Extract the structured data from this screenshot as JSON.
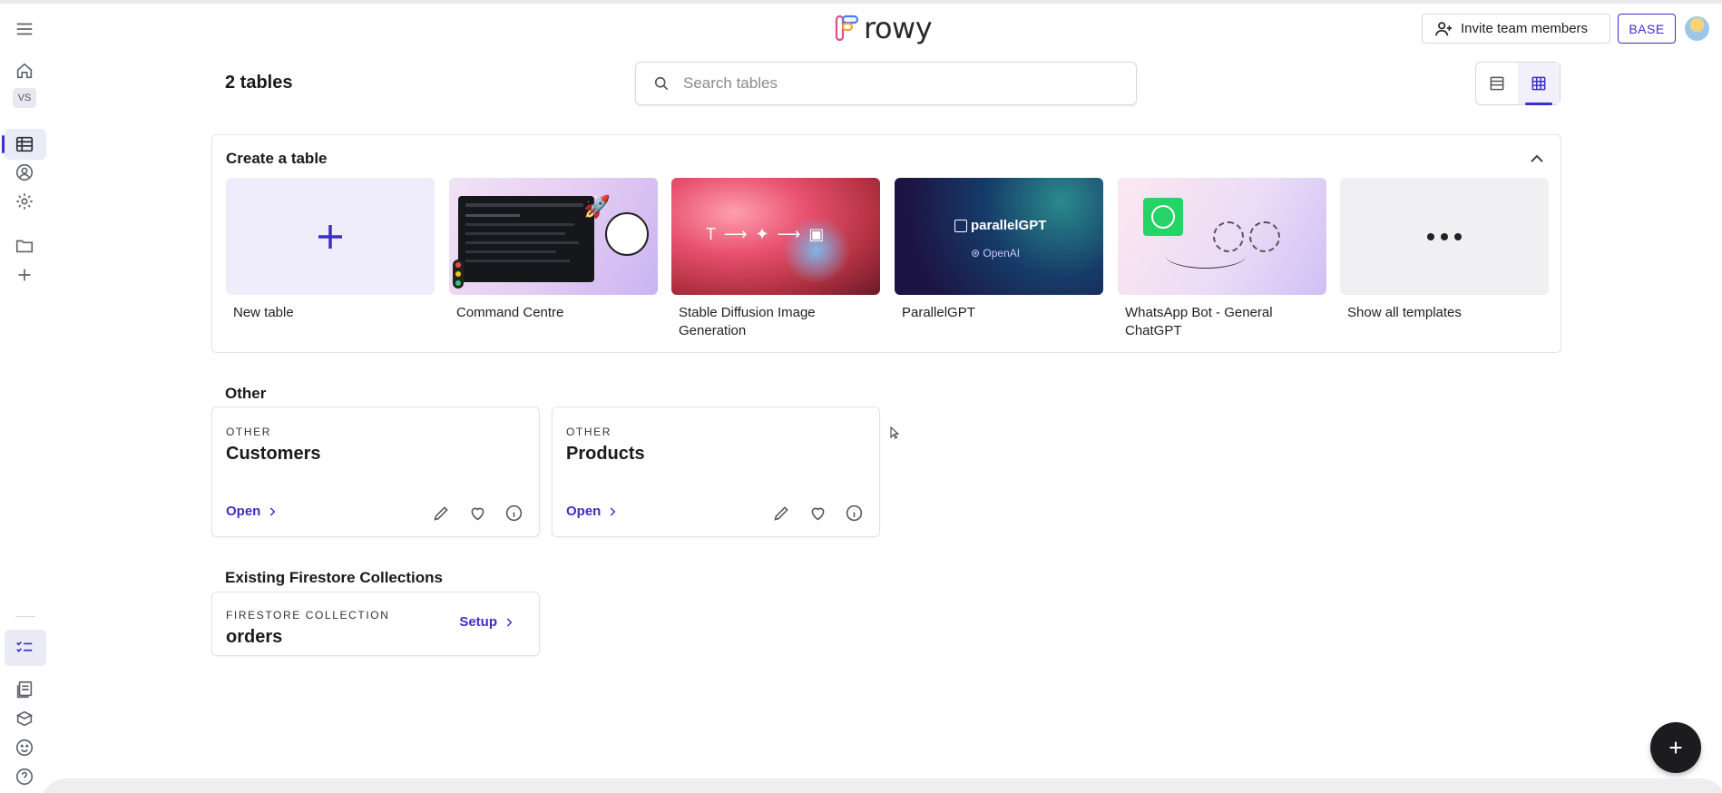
{
  "app": {
    "logo_text": "rowy"
  },
  "header": {
    "invite_label": "Invite team members",
    "base_label": "BASE"
  },
  "sidebar": {
    "workspace_badge": "VS",
    "items": [
      "menu",
      "home",
      "workspace",
      "tables",
      "users",
      "settings",
      "folder",
      "add",
      "checklist",
      "docs",
      "learn",
      "feedback",
      "help"
    ]
  },
  "tables_header": {
    "count_label": "2 tables",
    "search_placeholder": "Search tables"
  },
  "create": {
    "title": "Create a table",
    "templates": [
      {
        "label": "New table"
      },
      {
        "label": "Command Centre"
      },
      {
        "label": "Stable Diffusion Image Generation"
      },
      {
        "label": "ParallelGPT",
        "thumb_title": "parallelGPT",
        "thumb_sub": "OpenAI"
      },
      {
        "label": "WhatsApp Bot - General ChatGPT"
      },
      {
        "label": "Show all templates"
      }
    ]
  },
  "sections": {
    "other": {
      "title": "Other",
      "tables": [
        {
          "category": "OTHER",
          "name": "Customers",
          "open_label": "Open"
        },
        {
          "category": "OTHER",
          "name": "Products",
          "open_label": "Open"
        }
      ]
    },
    "firestore": {
      "title": "Existing Firestore Collections",
      "collections": [
        {
          "category": "FIRESTORE COLLECTION",
          "name": "orders",
          "setup_label": "Setup"
        }
      ]
    }
  },
  "colors": {
    "accent": "#3b2fc9",
    "fab": "#1c1c1f"
  }
}
